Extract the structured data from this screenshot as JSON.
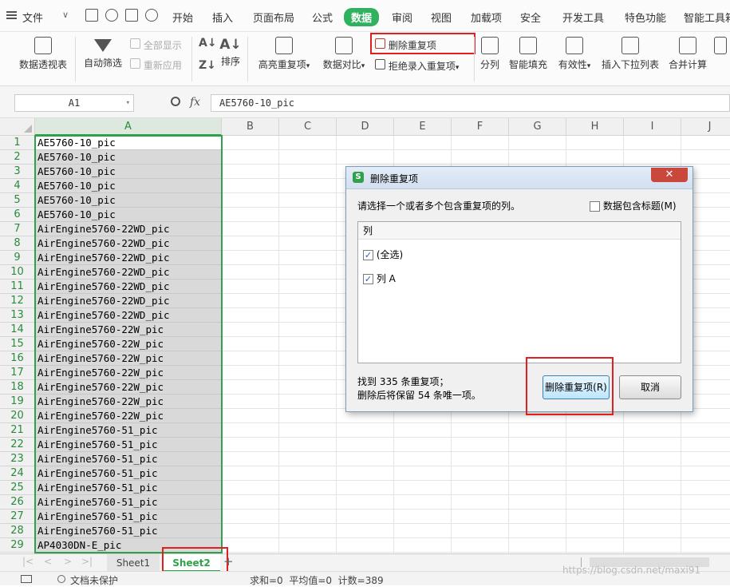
{
  "menubar": {
    "file": "文件",
    "items": [
      "开始",
      "插入",
      "页面布局",
      "公式",
      "数据",
      "审阅",
      "视图",
      "加载项",
      "安全",
      "开发工具",
      "特色功能",
      "智能工具箱"
    ],
    "active": "数据"
  },
  "ribbon": {
    "pivot": "数据透视表",
    "autofilter": "自动筛选",
    "show_all": "全部显示",
    "reapply": "重新应用",
    "sort": "排序",
    "highlight_dup": "高亮重复项",
    "data_compare": "数据对比",
    "remove_dup": "删除重复项",
    "reject_dup": "拒绝录入重复项",
    "split": "分列",
    "smart_fill": "智能填充",
    "validity": "有效性",
    "insert_dropdown": "插入下拉列表",
    "merge_calc": "合并计算"
  },
  "formula_bar": {
    "name_box": "A1",
    "fx": "fx",
    "value": "AE5760-10_pic"
  },
  "columns": [
    "A",
    "B",
    "C",
    "D",
    "E",
    "F",
    "G",
    "H",
    "I",
    "J"
  ],
  "rows": [
    {
      "n": "1",
      "v": "AE5760-10_pic"
    },
    {
      "n": "2",
      "v": "AE5760-10_pic"
    },
    {
      "n": "3",
      "v": "AE5760-10_pic"
    },
    {
      "n": "4",
      "v": "AE5760-10_pic"
    },
    {
      "n": "5",
      "v": "AE5760-10_pic"
    },
    {
      "n": "6",
      "v": "AE5760-10_pic"
    },
    {
      "n": "7",
      "v": "AirEngine5760-22WD_pic"
    },
    {
      "n": "8",
      "v": "AirEngine5760-22WD_pic"
    },
    {
      "n": "9",
      "v": "AirEngine5760-22WD_pic"
    },
    {
      "n": "10",
      "v": "AirEngine5760-22WD_pic"
    },
    {
      "n": "11",
      "v": "AirEngine5760-22WD_pic"
    },
    {
      "n": "12",
      "v": "AirEngine5760-22WD_pic"
    },
    {
      "n": "13",
      "v": "AirEngine5760-22WD_pic"
    },
    {
      "n": "14",
      "v": "AirEngine5760-22W_pic"
    },
    {
      "n": "15",
      "v": "AirEngine5760-22W_pic"
    },
    {
      "n": "16",
      "v": "AirEngine5760-22W_pic"
    },
    {
      "n": "17",
      "v": "AirEngine5760-22W_pic"
    },
    {
      "n": "18",
      "v": "AirEngine5760-22W_pic"
    },
    {
      "n": "19",
      "v": "AirEngine5760-22W_pic"
    },
    {
      "n": "20",
      "v": "AirEngine5760-22W_pic"
    },
    {
      "n": "21",
      "v": "AirEngine5760-51_pic"
    },
    {
      "n": "22",
      "v": "AirEngine5760-51_pic"
    },
    {
      "n": "23",
      "v": "AirEngine5760-51_pic"
    },
    {
      "n": "24",
      "v": "AirEngine5760-51_pic"
    },
    {
      "n": "25",
      "v": "AirEngine5760-51_pic"
    },
    {
      "n": "26",
      "v": "AirEngine5760-51_pic"
    },
    {
      "n": "27",
      "v": "AirEngine5760-51_pic"
    },
    {
      "n": "28",
      "v": "AirEngine5760-51_pic"
    },
    {
      "n": "29",
      "v": "AP4030DN-E_pic"
    }
  ],
  "sheets": [
    "Sheet1",
    "Sheet2"
  ],
  "active_sheet": "Sheet2",
  "status": {
    "doc_unprotected": "文档未保护",
    "summary": "求和=0  平均值=0  计数=389"
  },
  "dialog": {
    "title": "删除重复项",
    "prompt": "请选择一个或者多个包含重复项的列。",
    "header_checkbox": "数据包含标题(M)",
    "list_header": "列",
    "options": [
      {
        "label": "(全选)",
        "checked": true
      },
      {
        "label": "列 A",
        "checked": true
      }
    ],
    "result_line1": "找到 335 条重复项；",
    "result_line2": "删除后将保留 54 条唯一项。",
    "confirm": "删除重复项(R)",
    "cancel": "取消"
  },
  "watermark": "https://blog.csdn.net/maxi91"
}
